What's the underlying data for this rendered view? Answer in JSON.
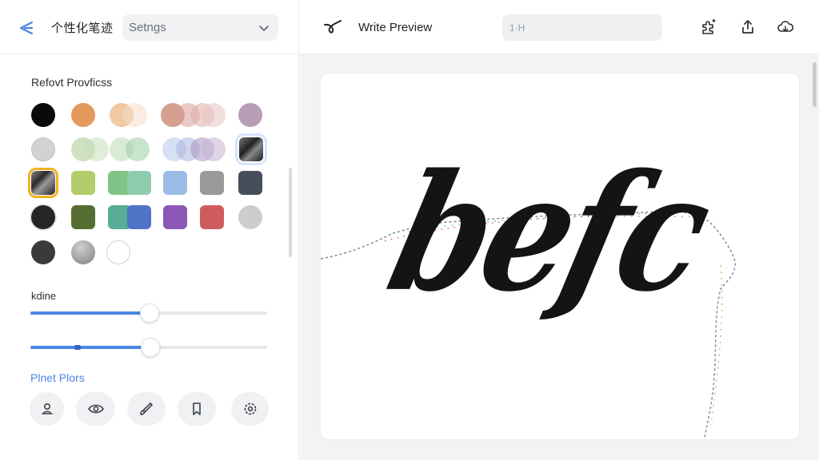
{
  "left_header": {
    "title": "个性化笔迹",
    "settings_select": {
      "value": "Setngs"
    }
  },
  "brush_presets": {
    "section_title": "Refovt Provficss"
  },
  "sliders": {
    "label": "kdine",
    "line_value": 0.5,
    "opacity_value": 0.5
  },
  "presets": {
    "title": "Plnet Plors"
  },
  "right_header": {
    "title": "Write Preview",
    "search_value": "1·H"
  },
  "canvas": {
    "text": "befc"
  },
  "colors": {
    "accent": "#4b86e6",
    "selected_outline": "#f2b21f"
  }
}
